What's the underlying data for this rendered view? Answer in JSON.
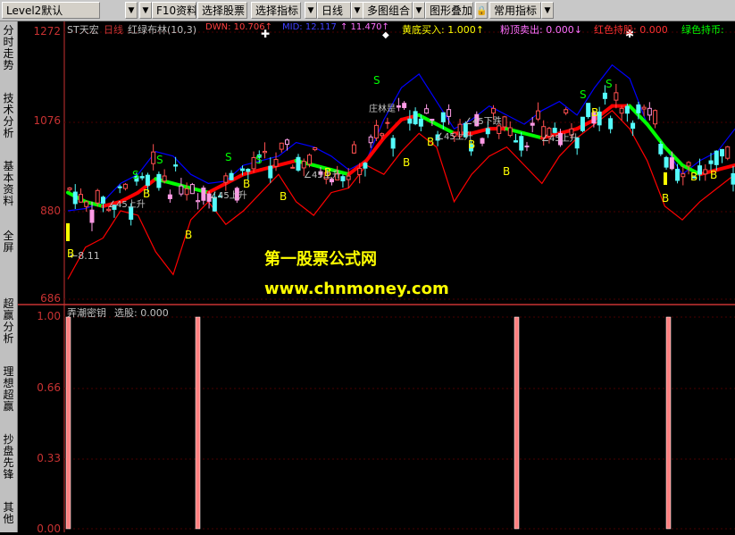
{
  "toolbar": {
    "level2": "Level2默认",
    "f10": "F10资料",
    "select_stock": "选择股票",
    "select_indicator": "选择指标",
    "daily": "日线",
    "multi_chart": "多图组合",
    "overlay": "图形叠加",
    "common_indicators": "常用指标"
  },
  "sidebar": {
    "tabs": [
      "分时走势",
      "技术分析",
      "基本资料",
      "全屏",
      "超赢分析",
      "理想超赢",
      "抄盘先锋",
      "其他"
    ]
  },
  "main_header": {
    "stock": "ST天宏",
    "period": "日线",
    "indicator": "红绿布林(10,3)",
    "dwn": "DWN: 10.706↑",
    "mid": "MID: 12.117",
    "up": "↑ 11.470↑",
    "yellow_buy": "黄底买入: 1.000↑",
    "pink_sell": "粉顶卖出: 0.000↓",
    "red_hold": "红色持股: 0.000",
    "green_hold": "绿色持币:"
  },
  "price_axis": {
    "labels": [
      "1272",
      "1076",
      "880",
      "686"
    ]
  },
  "annotations": {
    "min_label": "←8.11",
    "rise_label": "∠45上升",
    "fall_label": "∠45下跌",
    "buy_mark": "B",
    "sell_mark": "S",
    "zhuang_label": "庄林是"
  },
  "sub_header": {
    "name": "弄潮密钥",
    "value": "选股: 0.000"
  },
  "sub_axis": {
    "labels": [
      "1.00",
      "0.66",
      "0.33",
      "0.00"
    ]
  },
  "watermark": {
    "line1": "第一股票公式网",
    "line2": "www.chnmoney.com"
  },
  "colors": {
    "up_candle": "#ff5050",
    "down_candle": "#54fcfc",
    "pink_candle": "#ff9be6",
    "red_band": "#ff0000",
    "green_band": "#00ff00",
    "upper_band": "#0000ff",
    "yellow": "#ffff00",
    "signal_bar": "#ff8080"
  },
  "chart_data": [
    {
      "type": "line",
      "title": "",
      "y_axis_labels": [
        1272,
        1076,
        880,
        686
      ],
      "series": [
        {
          "values": [
            880,
            885,
            900,
            940,
            960,
            1010,
            1000,
            960,
            940,
            945,
            980,
            990,
            1000,
            1030,
            1020,
            1000,
            970,
            990,
            1080,
            1150,
            1180,
            1120,
            1060,
            1080,
            1110,
            1090,
            1070,
            1100,
            1120,
            1090,
            1150,
            1200,
            1170,
            1070,
            1020,
            960,
            990,
            1010,
            1060
          ]
        },
        {
          "values": [
            730,
            800,
            820,
            880,
            870,
            790,
            740,
            860,
            900,
            850,
            880,
            920,
            960,
            900,
            870,
            920,
            930,
            980,
            960,
            1010,
            1050,
            1020,
            900,
            960,
            1000,
            1020,
            980,
            940,
            1000,
            1040,
            1070,
            1100,
            1060,
            990,
            890,
            860,
            900,
            930,
            960
          ]
        },
        {
          "values": [
            920,
            900,
            890,
            900,
            920,
            950,
            940,
            930,
            920,
            940,
            960,
            970,
            980,
            990,
            980,
            970,
            960,
            990,
            1040,
            1080,
            1090,
            1070,
            1050,
            1050,
            1060,
            1060,
            1050,
            1040,
            1050,
            1060,
            1080,
            1110,
            1110,
            1070,
            1020,
            980,
            960,
            970,
            980
          ]
        }
      ]
    },
    {
      "type": "bar",
      "title": "",
      "y_axis_labels": [
        1.0,
        0.66,
        0.33,
        0.0
      ],
      "series": [
        {
          "values": [
            1,
            1,
            1,
            1
          ]
        }
      ]
    }
  ]
}
